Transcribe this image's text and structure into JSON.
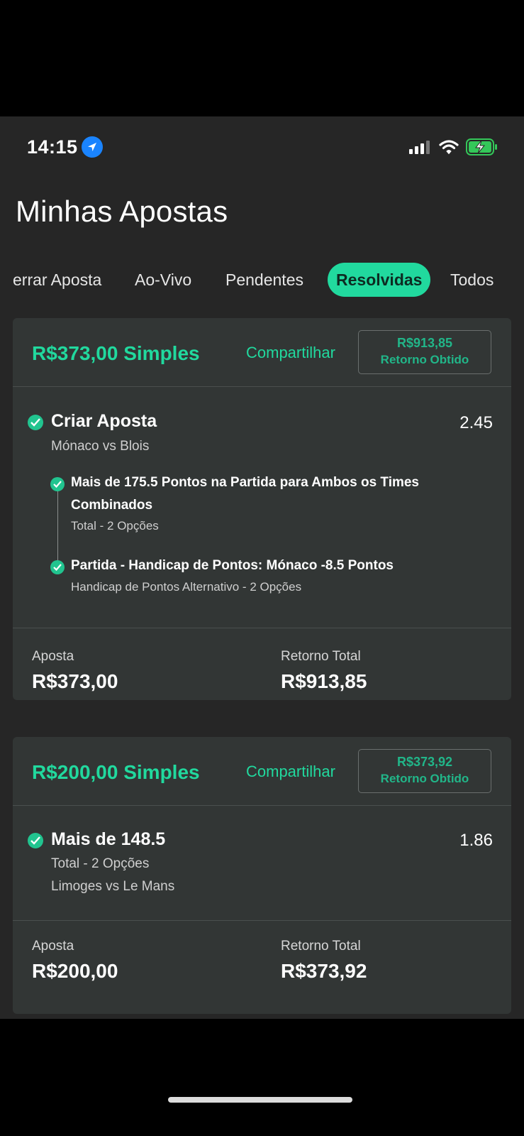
{
  "status": {
    "time": "14:15"
  },
  "page": {
    "title": "Minhas Apostas"
  },
  "tabs": [
    "errar Aposta",
    "Ao-Vivo",
    "Pendentes",
    "Resolvidas",
    "Todos"
  ],
  "colors": {
    "accent": "#21d99e",
    "card": "#323635",
    "background": "#262626"
  },
  "bets": [
    {
      "stake_title": "R$373,00 Simples",
      "share_label": "Compartilhar",
      "return_amount": "R$913,85",
      "return_label": "Retorno Obtido",
      "selection_title": "Criar Aposta",
      "odds": "2.45",
      "match": "Mónaco vs Blois",
      "legs": [
        {
          "title": "Mais de 175.5 Pontos na Partida para Ambos os Times Combinados",
          "subtitle": "Total - 2 Opções"
        },
        {
          "title": "Partida - Handicap de Pontos: Mónaco -8.5 Pontos",
          "subtitle": "Handicap de Pontos Alternativo - 2 Opções"
        }
      ],
      "stake_label": "Aposta",
      "stake_value": "R$373,00",
      "total_return_label": "Retorno Total",
      "total_return_value": "R$913,85"
    },
    {
      "stake_title": "R$200,00 Simples",
      "share_label": "Compartilhar",
      "return_amount": "R$373,92",
      "return_label": "Retorno Obtido",
      "selection_title": "Mais de 148.5",
      "odds": "1.86",
      "market": "Total - 2 Opções",
      "match": "Limoges vs Le Mans",
      "stake_label": "Aposta",
      "stake_value": "R$200,00",
      "total_return_label": "Retorno Total",
      "total_return_value": "R$373,92"
    }
  ]
}
